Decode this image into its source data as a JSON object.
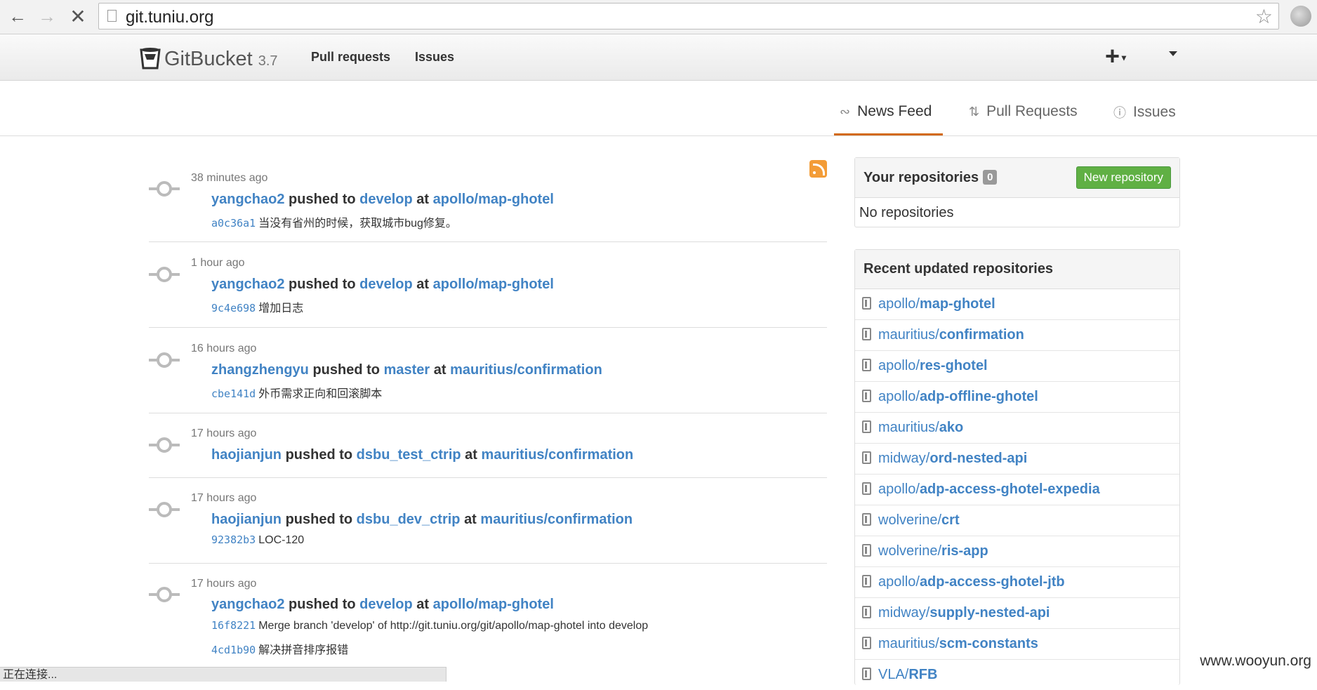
{
  "browser": {
    "url": "git.tuniu.org",
    "status": "正在连接..."
  },
  "header": {
    "logo_name": "GitBucket",
    "version": "3.7",
    "nav": [
      "Pull requests",
      "Issues"
    ],
    "plus": "+"
  },
  "tabs": [
    {
      "label": "News Feed",
      "icon": "rss-icon",
      "active": true
    },
    {
      "label": "Pull Requests",
      "icon": "pull-request-icon",
      "active": false
    },
    {
      "label": "Issues",
      "icon": "issue-icon",
      "active": false
    }
  ],
  "feed": [
    {
      "time": "38 minutes ago",
      "user": "yangchao2",
      "verb": "pushed to",
      "branch": "develop",
      "at": "at",
      "repo": "apollo/map-ghotel",
      "commits": [
        {
          "sha": "a0c36a1",
          "msg": "当没有省州的时候，获取城市bug修复。"
        }
      ]
    },
    {
      "time": "1 hour ago",
      "user": "yangchao2",
      "verb": "pushed to",
      "branch": "develop",
      "at": "at",
      "repo": "apollo/map-ghotel",
      "commits": [
        {
          "sha": "9c4e698",
          "msg": "增加日志"
        }
      ]
    },
    {
      "time": "16 hours ago",
      "user": "zhangzhengyu",
      "verb": "pushed to",
      "branch": "master",
      "at": "at",
      "repo": "mauritius/confirmation",
      "commits": [
        {
          "sha": "cbe141d",
          "msg": "外币需求正向和回滚脚本"
        }
      ]
    },
    {
      "time": "17 hours ago",
      "user": "haojianjun",
      "verb": "pushed to",
      "branch": "dsbu_test_ctrip",
      "at": "at",
      "repo": "mauritius/confirmation",
      "commits": []
    },
    {
      "time": "17 hours ago",
      "user": "haojianjun",
      "verb": "pushed to",
      "branch": "dsbu_dev_ctrip",
      "at": "at",
      "repo": "mauritius/confirmation",
      "commits": [
        {
          "sha": "92382b3",
          "msg": "LOC-120"
        }
      ]
    },
    {
      "time": "17 hours ago",
      "user": "yangchao2",
      "verb": "pushed to",
      "branch": "develop",
      "at": "at",
      "repo": "apollo/map-ghotel",
      "commits": [
        {
          "sha": "16f8221",
          "msg": "Merge branch 'develop' of http://git.tuniu.org/git/apollo/map-ghotel into develop"
        },
        {
          "sha": "4cd1b90",
          "msg": "解决拼音排序报错"
        }
      ]
    }
  ],
  "your_repos": {
    "title": "Your repositories",
    "count": "0",
    "new_label": "New repository",
    "empty": "No repositories"
  },
  "recent": {
    "title": "Recent updated repositories",
    "repos": [
      {
        "owner": "apollo/",
        "name": "map-ghotel"
      },
      {
        "owner": "mauritius/",
        "name": "confirmation"
      },
      {
        "owner": "apollo/",
        "name": "res-ghotel"
      },
      {
        "owner": "apollo/",
        "name": "adp-offline-ghotel"
      },
      {
        "owner": "mauritius/",
        "name": "ako"
      },
      {
        "owner": "midway/",
        "name": "ord-nested-api"
      },
      {
        "owner": "apollo/",
        "name": "adp-access-ghotel-expedia"
      },
      {
        "owner": "wolverine/",
        "name": "crt"
      },
      {
        "owner": "wolverine/",
        "name": "ris-app"
      },
      {
        "owner": "apollo/",
        "name": "adp-access-ghotel-jtb"
      },
      {
        "owner": "midway/",
        "name": "supply-nested-api"
      },
      {
        "owner": "mauritius/",
        "name": "scm-constants"
      },
      {
        "owner": "VLA/",
        "name": "RFB"
      }
    ]
  },
  "watermark": "www.wooyun.org"
}
